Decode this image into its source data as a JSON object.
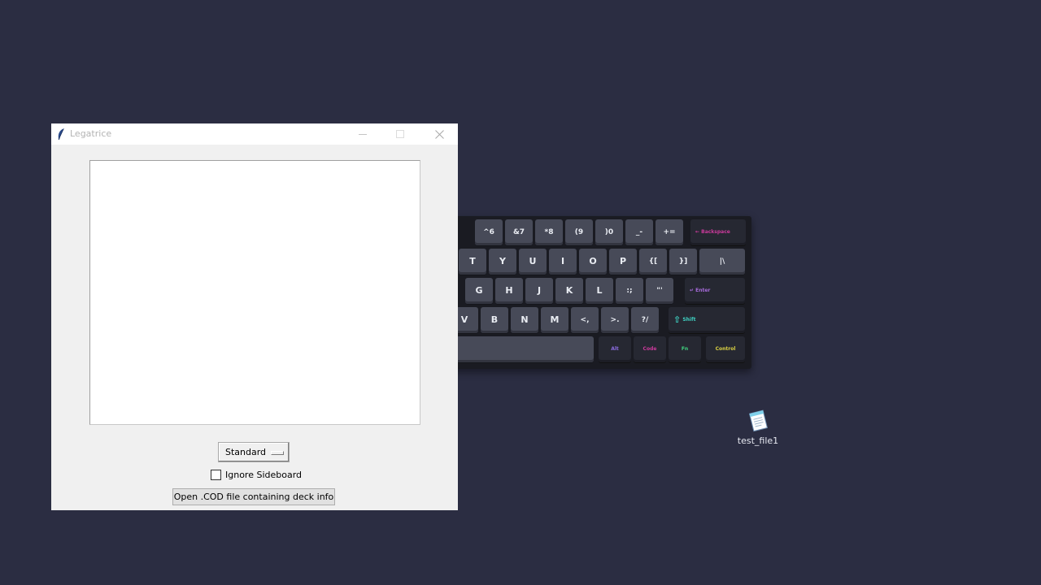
{
  "colors": {
    "desktop_bg": "#2b2d42",
    "window_bg": "#f0f0f0",
    "title_text": "#b3b3b3",
    "key_cap": "#474a58",
    "key_backspace": "#cc3a9c",
    "key_enter": "#a56ad8",
    "key_shift": "#3fd1c2",
    "key_alt": "#8b6ce0",
    "key_code": "#cc3a9c",
    "key_fn": "#3fd27f",
    "key_control": "#d9d043"
  },
  "window": {
    "title": "Legatrice",
    "icon": "feather-icon",
    "controls": {
      "minimize_icon": "minimize-icon",
      "maximize_icon": "maximize-icon",
      "close_icon": "close-icon"
    }
  },
  "format_menu": {
    "selected": "Standard"
  },
  "ignore_sideboard": {
    "label": "Ignore Sideboard",
    "checked": false
  },
  "open_button": {
    "label": "Open .COD file containing deck info"
  },
  "desktop_icons": [
    {
      "label": "test_file1",
      "icon": "notepad-file-icon"
    }
  ],
  "keyboard": {
    "number_row": [
      {
        "top": "^",
        "bottom": "6"
      },
      {
        "top": "&",
        "bottom": "7"
      },
      {
        "top": "*",
        "bottom": "8"
      },
      {
        "top": "(",
        "bottom": "9"
      },
      {
        "top": ")",
        "bottom": "0"
      },
      {
        "top": "_",
        "bottom": "-"
      },
      {
        "top": "+",
        "bottom": "="
      }
    ],
    "backspace": "Backspace",
    "top_row": [
      "T",
      "Y",
      "U",
      "I",
      "O",
      "P"
    ],
    "top_row_symbols": [
      {
        "top": "{",
        "bottom": "["
      },
      {
        "top": "}",
        "bottom": "]"
      },
      {
        "top": "|",
        "bottom": "\\"
      }
    ],
    "home_row": [
      "G",
      "H",
      "J",
      "K",
      "L"
    ],
    "home_row_symbols": [
      {
        "top": ":",
        "bottom": ";"
      },
      {
        "top": "\"",
        "bottom": "'"
      }
    ],
    "enter": "Enter",
    "bottom_row": [
      "V",
      "B",
      "N",
      "M"
    ],
    "bottom_row_symbols": [
      {
        "top": "<",
        "bottom": ","
      },
      {
        "top": ">",
        "bottom": "."
      },
      {
        "top": "?",
        "bottom": "/"
      }
    ],
    "shift": "Shift",
    "mods": [
      "Alt",
      "Code",
      "Fn",
      "Control"
    ]
  }
}
